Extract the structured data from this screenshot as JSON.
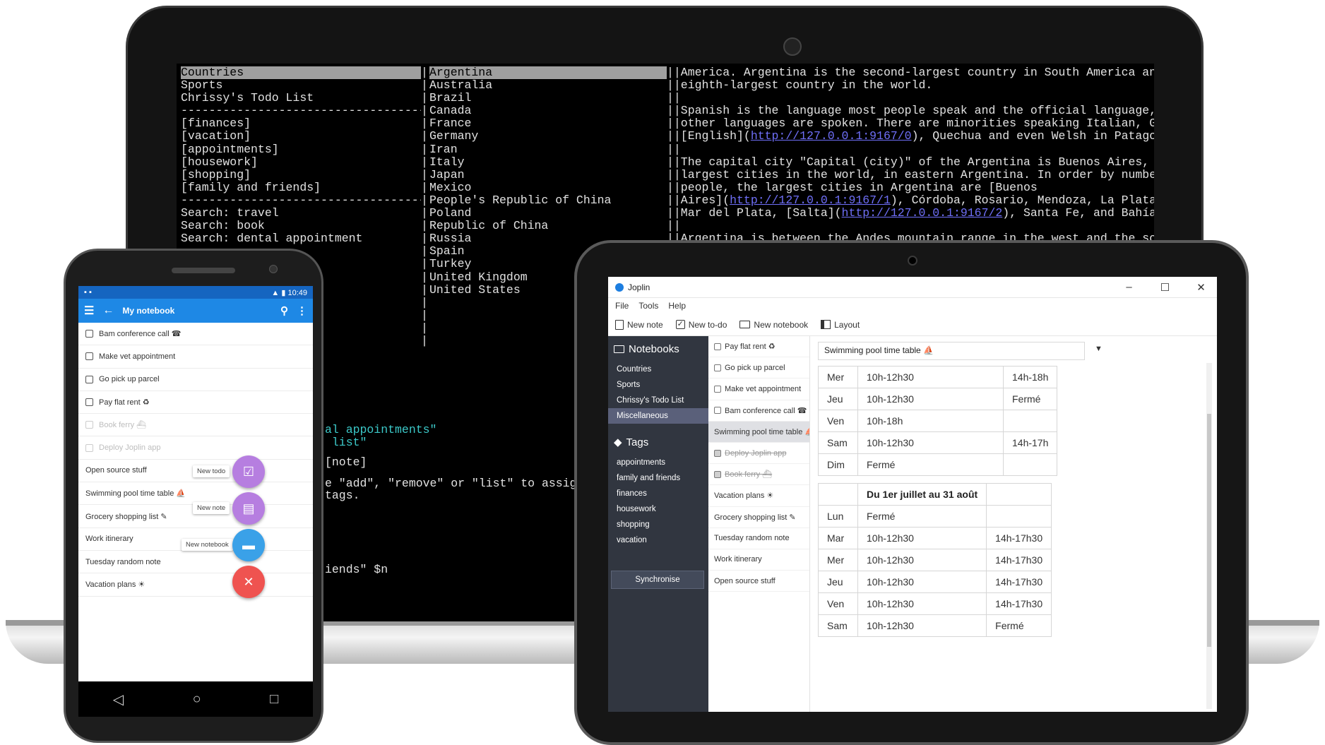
{
  "terminal": {
    "col1": [
      "Countries",
      "Sports",
      "Chrissy's Todo List",
      "-----------------------------------",
      "[finances]",
      "[vacation]",
      "[appointments]",
      "[housework]",
      "[shopping]",
      "[family and friends]",
      "---------------------------------------",
      "Search: travel",
      "Search: book",
      "Search: dental appointment"
    ],
    "col2": [
      "Argentina",
      "Australia",
      "Brazil",
      "Canada",
      "France",
      "Germany",
      "Iran",
      "Italy",
      "Japan",
      "Mexico",
      "People's Republic of China",
      "Poland",
      "Republic of China",
      "Russia",
      "Spain",
      "Turkey",
      "United Kingdom",
      "United States"
    ],
    "col3": [
      "||America. Argentina is the second-largest country in South America and the",
      "||eighth-largest country in the world.",
      "||",
      "||Spanish is the language most people speak and the official language, but many",
      "||other languages are spoken. There are minorities speaking Italian, German,",
      "||[English](",
      "||",
      "||The capital city \"Capital (city)\" of the Argentina is Buenos Aires, one of the",
      "||largest cities in the world, in eastern Argentina. In order by number of",
      "||people, the largest cities in Argentina are [Buenos",
      "||Aires](",
      "||Mar del Plata, [Salta](",
      "||"
    ],
    "link_english": "http://127.0.0.1:9167/0",
    "after_english": "), Quechua and even Welsh in Patagonia.",
    "link_buenos": "http://127.0.0.1:9167/1",
    "after_buenos": "), Córdoba, Rosario, Mendoza, La Plata, Tucumán,",
    "link_salta": "http://127.0.0.1:9167/2",
    "after_salta": "), Santa Fe, and Bahía Blanca.",
    "cut_line": "||Argentina is between the Andes mountain range in the west and the southern",
    "cmd_lines": [
      "al appointments\"",
      " list\"",
      "[note]",
      "e \"add\", \"remove\" or \"list\" to assign or r",
      "tags."
    ],
    "prompt_tail": "iends\" $n"
  },
  "phone": {
    "status_time": "10:49",
    "title": "My notebook",
    "items": [
      {
        "label": "Bam conference call ☎",
        "checkbox": true,
        "done": false
      },
      {
        "label": "Make vet appointment",
        "checkbox": true,
        "done": false
      },
      {
        "label": "Go pick up parcel",
        "checkbox": true,
        "done": false
      },
      {
        "label": "Pay flat rent ♻",
        "checkbox": true,
        "done": false
      },
      {
        "label": "Book ferry ⛴",
        "checkbox": true,
        "done": true
      },
      {
        "label": "Deploy Joplin app",
        "checkbox": true,
        "done": true
      },
      {
        "label": "Open source stuff",
        "checkbox": false,
        "done": false
      },
      {
        "label": "Swimming pool time table ⛵",
        "checkbox": false,
        "done": false
      },
      {
        "label": "Grocery shopping list ✎",
        "checkbox": false,
        "done": false
      },
      {
        "label": "Work itinerary",
        "checkbox": false,
        "done": false
      },
      {
        "label": "Tuesday random note",
        "checkbox": false,
        "done": false
      },
      {
        "label": "Vacation plans ☀",
        "checkbox": false,
        "done": false
      }
    ],
    "fab_new_todo": "New todo",
    "fab_new_note": "New note",
    "fab_new_notebook": "New notebook",
    "colors": {
      "appbar": "#1e88e5",
      "status": "#1565c0",
      "fab_purple": "#b67ee0",
      "fab_blue": "#3aa1e8",
      "fab_red": "#ef5350"
    }
  },
  "joplin": {
    "window_title": "Joplin",
    "menu": [
      "File",
      "Tools",
      "Help"
    ],
    "toolbar": {
      "new_note": "New note",
      "new_todo": "New to-do",
      "new_notebook": "New notebook",
      "layout": "Layout"
    },
    "sidebar": {
      "notebooks_header": "Notebooks",
      "notebooks": [
        "Countries",
        "Sports",
        "Chrissy's Todo List",
        "Miscellaneous"
      ],
      "active_notebook": "Miscellaneous",
      "tags_header": "Tags",
      "tags": [
        "appointments",
        "family and friends",
        "finances",
        "housework",
        "shopping",
        "vacation"
      ],
      "sync": "Synchronise"
    },
    "notes": [
      {
        "label": "Pay flat rent ♻",
        "todo": true,
        "done": false
      },
      {
        "label": "Go pick up parcel",
        "todo": true,
        "done": false
      },
      {
        "label": "Make vet appointment",
        "todo": true,
        "done": false
      },
      {
        "label": "Bam conference call ☎",
        "todo": true,
        "done": false
      },
      {
        "label": "Swimming pool time table ⛵",
        "todo": false,
        "done": false,
        "selected": true
      },
      {
        "label": "Deploy Joplin app",
        "todo": true,
        "done": true
      },
      {
        "label": "Book ferry ⛴",
        "todo": true,
        "done": true
      },
      {
        "label": "Vacation plans ☀",
        "todo": false,
        "done": false
      },
      {
        "label": "Grocery shopping list ✎",
        "todo": false,
        "done": false
      },
      {
        "label": "Tuesday random note",
        "todo": false,
        "done": false
      },
      {
        "label": "Work itinerary",
        "todo": false,
        "done": false
      },
      {
        "label": "Open source stuff",
        "todo": false,
        "done": false
      }
    ],
    "note_title": "Swimming pool time table ⛵",
    "table1": [
      [
        "Mer",
        "10h-12h30",
        "14h-18h"
      ],
      [
        "Jeu",
        "10h-12h30",
        "Fermé"
      ],
      [
        "Ven",
        "10h-18h",
        ""
      ],
      [
        "Sam",
        "10h-12h30",
        "14h-17h"
      ],
      [
        "Dim",
        "Fermé",
        ""
      ]
    ],
    "table2_header": "Du 1er juillet au 31 août",
    "table2": [
      [
        "Lun",
        "Fermé",
        ""
      ],
      [
        "Mar",
        "10h-12h30",
        "14h-17h30"
      ],
      [
        "Mer",
        "10h-12h30",
        "14h-17h30"
      ],
      [
        "Jeu",
        "10h-12h30",
        "14h-17h30"
      ],
      [
        "Ven",
        "10h-12h30",
        "14h-17h30"
      ],
      [
        "Sam",
        "10h-12h30",
        "Fermé"
      ]
    ],
    "colors": {
      "sidebar": "#313640",
      "sidebar_active": "#5a607a"
    }
  }
}
